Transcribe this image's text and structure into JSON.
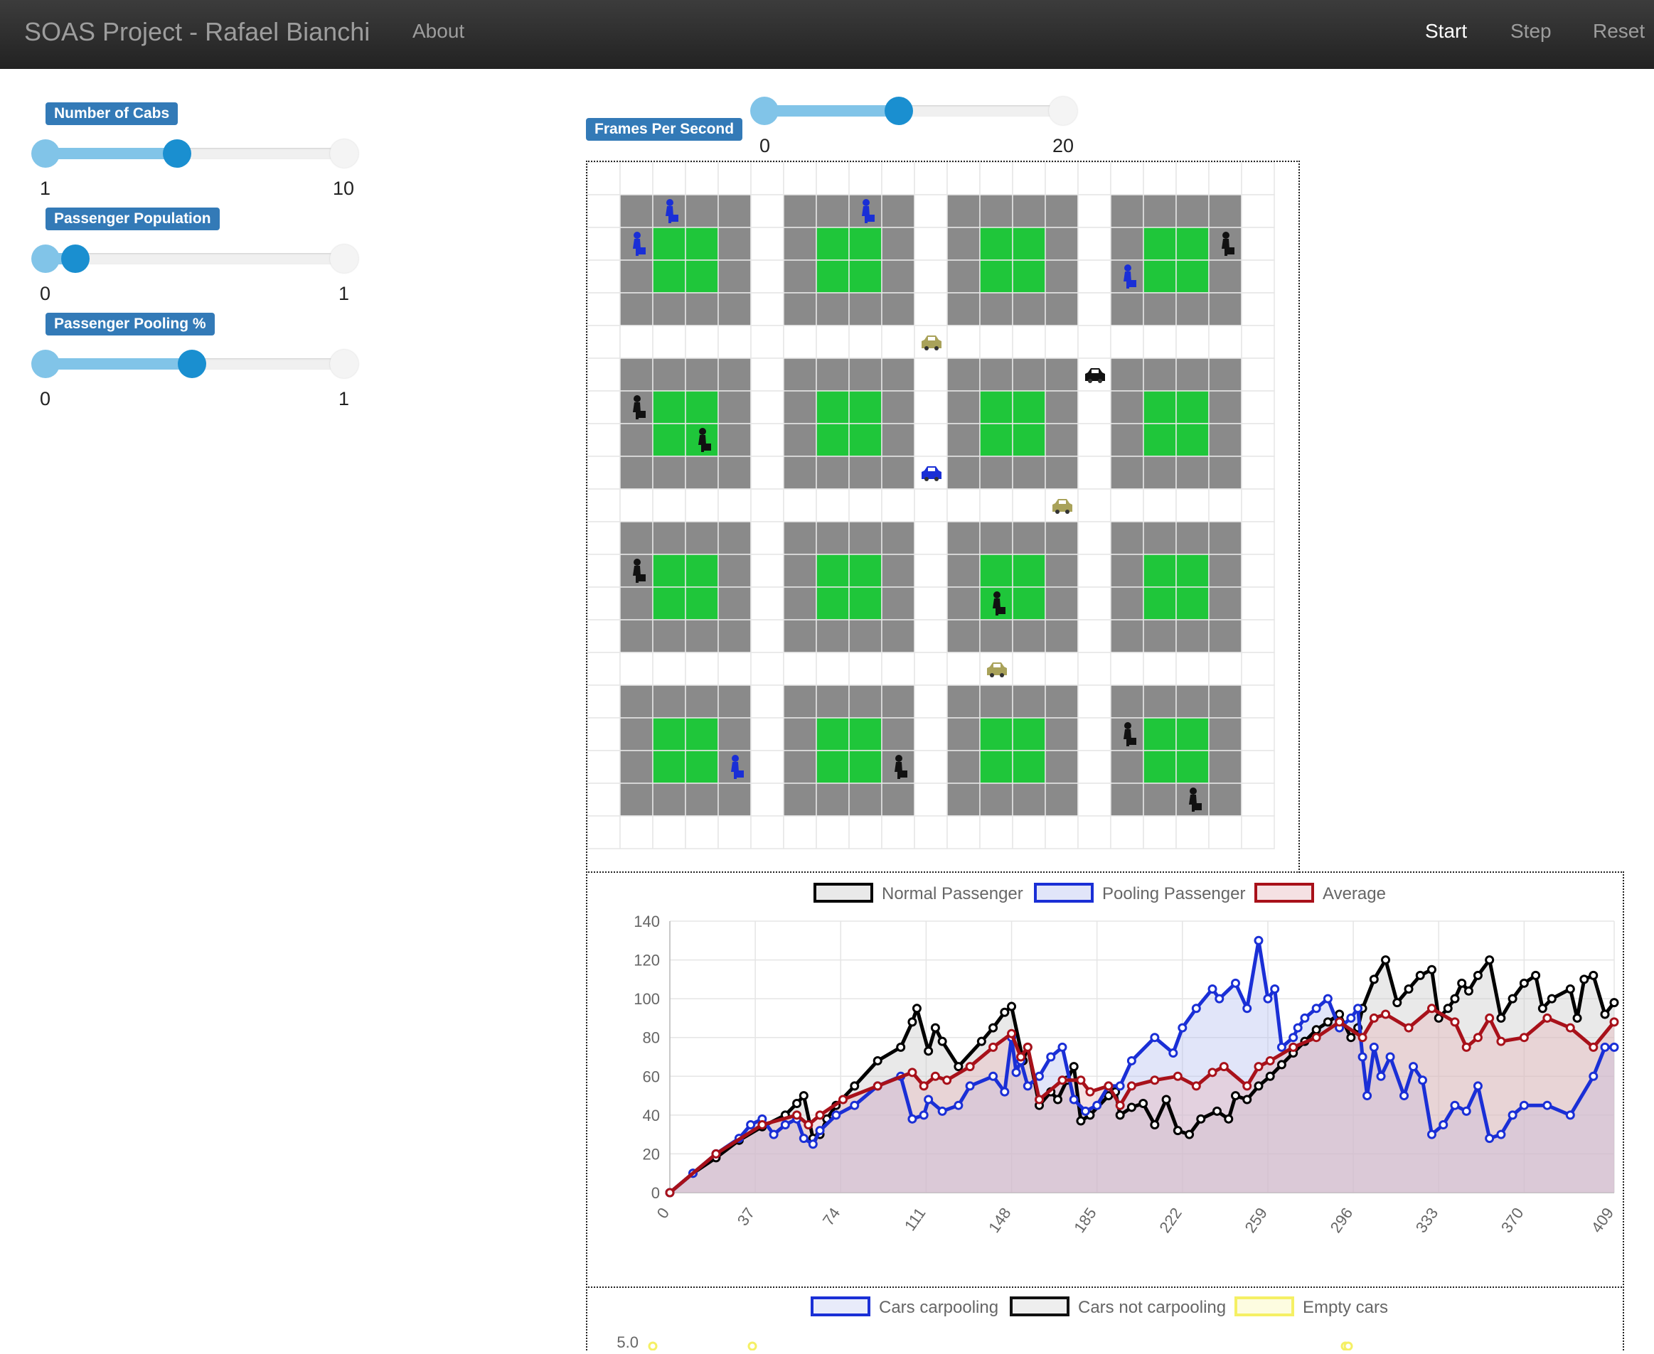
{
  "navbar": {
    "brand": "SOAS Project - Rafael Bianchi",
    "about": "About",
    "start": "Start",
    "step": "Step",
    "reset": "Reset"
  },
  "sliders": [
    {
      "id": "cabs",
      "label": "Number of Cabs",
      "min": "1",
      "max": "10",
      "fraction": 0.44
    },
    {
      "id": "population",
      "label": "Passenger Population",
      "min": "0",
      "max": "1",
      "fraction": 0.1
    },
    {
      "id": "pooling",
      "label": "Passenger Pooling %",
      "min": "0",
      "max": "1",
      "fraction": 0.49
    }
  ],
  "fps": {
    "label": "Frames Per Second",
    "min": "0",
    "max": "20",
    "fraction": 0.45
  },
  "colors": {
    "block": "#8a8a8a",
    "park": "#1fc63a",
    "blue": "#1a2fd6",
    "black": "#111111",
    "red": "#a8111a",
    "taxi": "#a9a25a"
  },
  "city": {
    "passengers": [
      {
        "row": 1,
        "col": 2,
        "color": "blue"
      },
      {
        "row": 2,
        "col": 1,
        "color": "blue"
      },
      {
        "row": 1,
        "col": 8,
        "color": "blue"
      },
      {
        "row": 2,
        "col": 19,
        "color": "black"
      },
      {
        "row": 3,
        "col": 16,
        "color": "blue"
      },
      {
        "row": 7,
        "col": 1,
        "color": "black"
      },
      {
        "row": 8,
        "col": 3,
        "color": "black"
      },
      {
        "row": 12,
        "col": 1,
        "color": "black"
      },
      {
        "row": 13,
        "col": 12,
        "color": "black"
      },
      {
        "row": 18,
        "col": 4,
        "color": "blue"
      },
      {
        "row": 18,
        "col": 9,
        "color": "black"
      },
      {
        "row": 17,
        "col": 16,
        "color": "black"
      },
      {
        "row": 19,
        "col": 18,
        "color": "black"
      }
    ],
    "cabs": [
      {
        "row": 5,
        "col": 10,
        "color": "taxi"
      },
      {
        "row": 6,
        "col": 15,
        "color": "black"
      },
      {
        "row": 9,
        "col": 10,
        "color": "blue"
      },
      {
        "row": 10,
        "col": 14,
        "color": "taxi"
      },
      {
        "row": 15,
        "col": 12,
        "color": "taxi"
      }
    ]
  },
  "chart_data": [
    {
      "type": "line",
      "legend": [
        "Normal Passenger",
        "Pooling Passenger",
        "Average"
      ],
      "legend_position": "top",
      "x_ticks": [
        "0",
        "37",
        "74",
        "111",
        "148",
        "185",
        "222",
        "259",
        "296",
        "333",
        "370",
        "409"
      ],
      "y_ticks": [
        "0",
        "20",
        "40",
        "60",
        "80",
        "100",
        "120",
        "140"
      ],
      "xlim": [
        0,
        409
      ],
      "ylim": [
        0,
        140
      ],
      "grid": true,
      "series": [
        {
          "name": "Normal Passenger",
          "color": "#000000",
          "fill": "rgba(200,200,200,0.4)",
          "x": [
            0,
            10,
            20,
            30,
            40,
            50,
            55,
            58,
            62,
            65,
            68,
            72,
            80,
            90,
            100,
            105,
            107,
            112,
            115,
            118,
            125,
            135,
            140,
            145,
            148,
            153,
            155,
            160,
            165,
            168,
            172,
            175,
            178,
            182,
            190,
            193,
            195,
            200,
            205,
            210,
            215,
            220,
            225,
            230,
            237,
            242,
            245,
            250,
            255,
            260,
            265,
            270,
            275,
            280,
            285,
            290,
            295,
            298,
            300,
            305,
            310,
            315,
            320,
            325,
            330,
            333,
            337,
            340,
            343,
            346,
            350,
            355,
            360,
            365,
            370,
            375,
            378,
            382,
            390,
            393,
            396,
            400,
            405,
            409
          ],
          "y": [
            0,
            10,
            18,
            27,
            34,
            40,
            46,
            50,
            28,
            30,
            38,
            45,
            55,
            68,
            75,
            88,
            95,
            73,
            85,
            78,
            65,
            78,
            85,
            93,
            96,
            68,
            75,
            45,
            52,
            48,
            58,
            65,
            37,
            40,
            50,
            52,
            40,
            44,
            46,
            35,
            48,
            32,
            30,
            38,
            42,
            38,
            50,
            48,
            55,
            60,
            66,
            72,
            78,
            84,
            88,
            92,
            80,
            85,
            95,
            110,
            120,
            98,
            105,
            112,
            115,
            90,
            95,
            100,
            108,
            104,
            112,
            120,
            90,
            100,
            108,
            112,
            95,
            100,
            105,
            90,
            110,
            112,
            92,
            98
          ]
        },
        {
          "name": "Pooling Passenger",
          "color": "#1a2fd6",
          "fill": "rgba(180,190,240,0.4)",
          "x": [
            0,
            10,
            20,
            30,
            35,
            40,
            45,
            50,
            55,
            58,
            62,
            65,
            72,
            80,
            90,
            100,
            105,
            110,
            112,
            118,
            125,
            130,
            140,
            145,
            148,
            150,
            152,
            155,
            160,
            165,
            170,
            175,
            180,
            185,
            190,
            195,
            200,
            210,
            218,
            222,
            228,
            235,
            238,
            245,
            250,
            255,
            259,
            262,
            265,
            270,
            272,
            275,
            280,
            285,
            290,
            295,
            298,
            300,
            302,
            305,
            308,
            312,
            318,
            322,
            326,
            330,
            335,
            340,
            345,
            350,
            355,
            360,
            365,
            370,
            380,
            390,
            400,
            405,
            409
          ],
          "y": [
            0,
            10,
            20,
            28,
            35,
            38,
            30,
            35,
            38,
            28,
            25,
            32,
            40,
            45,
            55,
            60,
            38,
            40,
            48,
            42,
            45,
            55,
            60,
            52,
            80,
            62,
            68,
            55,
            60,
            70,
            75,
            48,
            42,
            45,
            55,
            55,
            68,
            80,
            72,
            85,
            95,
            105,
            100,
            108,
            95,
            130,
            100,
            105,
            75,
            80,
            85,
            90,
            95,
            100,
            85,
            90,
            95,
            70,
            50,
            75,
            60,
            70,
            50,
            65,
            58,
            30,
            35,
            45,
            42,
            55,
            28,
            30,
            40,
            45,
            45,
            40,
            60,
            75,
            75
          ]
        },
        {
          "name": "Average",
          "color": "#a8111a",
          "fill": "rgba(230,180,185,0.4)",
          "x": [
            0,
            20,
            40,
            55,
            60,
            65,
            75,
            90,
            105,
            110,
            115,
            120,
            130,
            140,
            148,
            152,
            155,
            160,
            170,
            178,
            182,
            190,
            195,
            200,
            210,
            220,
            228,
            235,
            240,
            250,
            255,
            260,
            270,
            280,
            290,
            300,
            305,
            310,
            320,
            330,
            340,
            345,
            350,
            355,
            360,
            370,
            380,
            390,
            400,
            409
          ],
          "y": [
            0,
            20,
            35,
            40,
            35,
            40,
            48,
            55,
            62,
            55,
            60,
            58,
            65,
            75,
            82,
            70,
            75,
            48,
            58,
            58,
            52,
            55,
            45,
            55,
            58,
            60,
            55,
            62,
            65,
            55,
            65,
            68,
            75,
            80,
            88,
            80,
            90,
            92,
            85,
            95,
            88,
            75,
            80,
            90,
            78,
            80,
            90,
            85,
            75,
            88
          ]
        }
      ]
    },
    {
      "type": "line",
      "legend": [
        "Cars carpooling",
        "Cars not carpooling",
        "Empty cars"
      ],
      "legend_position": "top",
      "y_ticks": [
        "5.0"
      ]
    }
  ]
}
